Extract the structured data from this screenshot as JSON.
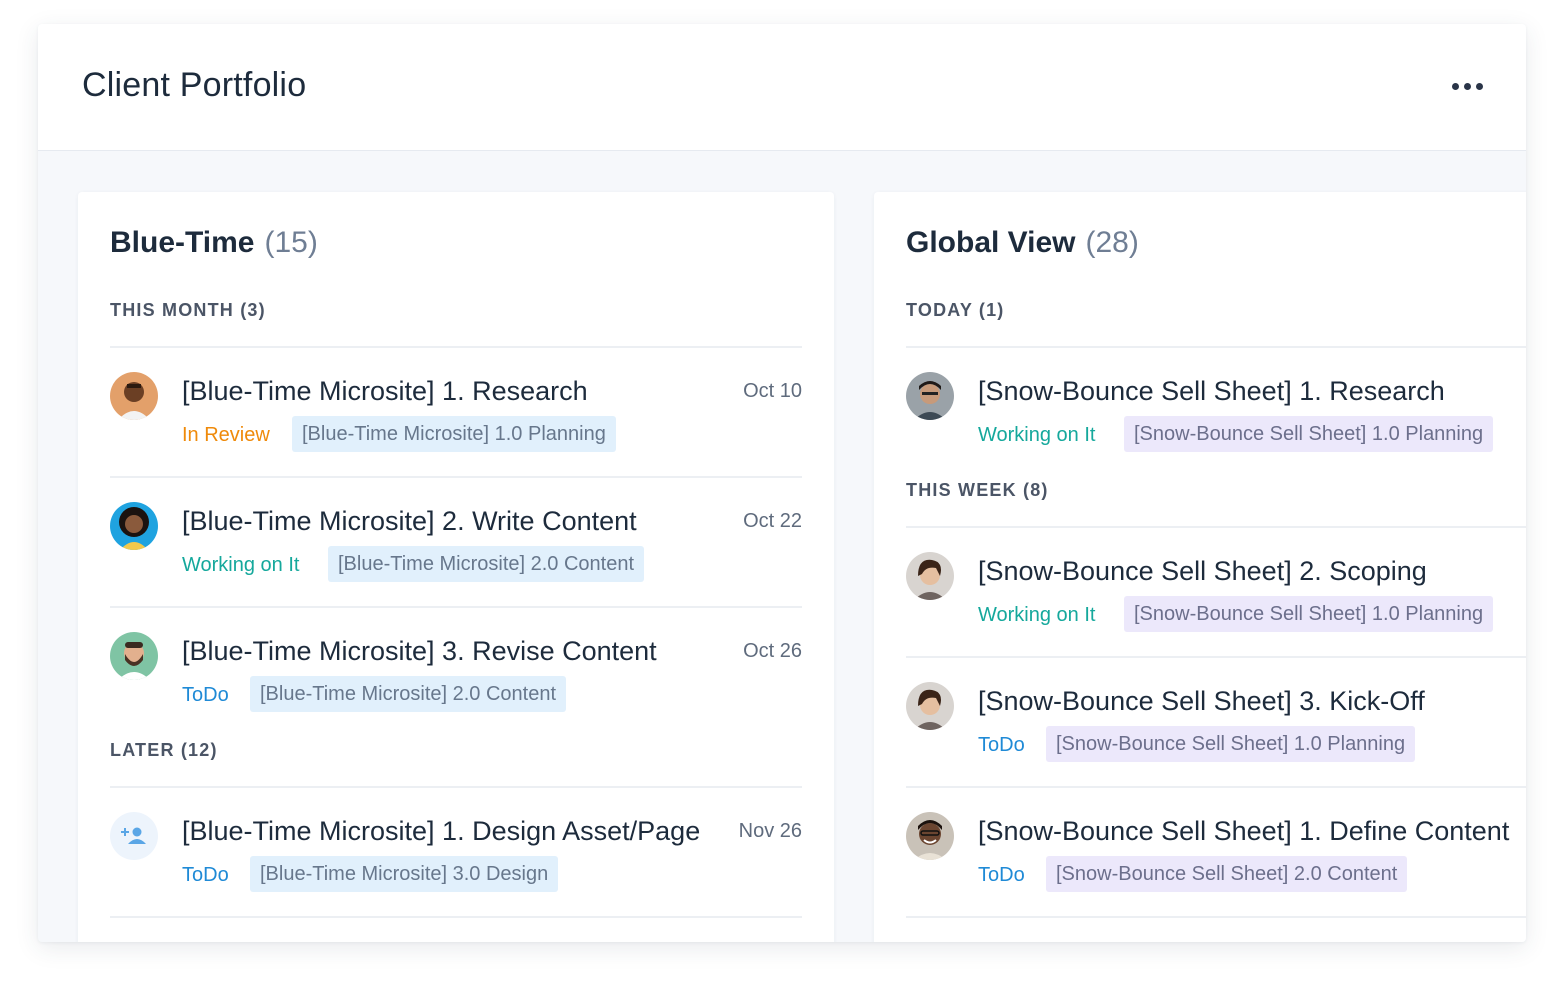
{
  "header": {
    "title": "Client Portfolio"
  },
  "panels": [
    {
      "title": "Blue-Time",
      "count": "(15)",
      "sections": [
        {
          "label": "THIS MONTH (3)",
          "tasks": [
            {
              "title": "[Blue-Time Microsite] 1. Research",
              "date": "Oct 10",
              "status": "In Review",
              "tag": "[Blue-Time Microsite] 1.0 Planning"
            },
            {
              "title": "[Blue-Time Microsite] 2. Write Content",
              "date": "Oct 22",
              "status": "Working on It",
              "tag": "[Blue-Time Microsite] 2.0 Content"
            },
            {
              "title": "[Blue-Time Microsite] 3. Revise Content",
              "date": "Oct 26",
              "status": "ToDo",
              "tag": "[Blue-Time Microsite] 2.0 Content"
            }
          ]
        },
        {
          "label": "LATER (12)",
          "tasks": [
            {
              "title": "[Blue-Time Microsite] 1. Design Asset/Page",
              "date": "Nov 26",
              "status": "ToDo",
              "tag": "[Blue-Time Microsite] 3.0 Design"
            }
          ]
        }
      ]
    },
    {
      "title": "Global View",
      "count": "(28)",
      "sections": [
        {
          "label": "TODAY (1)",
          "tasks": [
            {
              "title": "[Snow-Bounce Sell Sheet] 1. Research",
              "status": "Working on It",
              "tag": "[Snow-Bounce Sell Sheet] 1.0 Planning"
            }
          ]
        },
        {
          "label": "THIS WEEK (8)",
          "tasks": [
            {
              "title": "[Snow-Bounce Sell Sheet] 2. Scoping",
              "status": "Working on It",
              "tag": "[Snow-Bounce Sell Sheet] 1.0 Planning"
            },
            {
              "title": "[Snow-Bounce Sell Sheet] 3. Kick-Off",
              "status": "ToDo",
              "tag": "[Snow-Bounce Sell Sheet] 1.0 Planning"
            },
            {
              "title": "[Snow-Bounce Sell Sheet] 1. Define Content",
              "status": "ToDo",
              "tag": "[Snow-Bounce Sell Sheet] 2.0 Content"
            }
          ]
        }
      ]
    }
  ],
  "colors": {
    "in_review": "#ef8a0a",
    "working_on_it": "#15a89c",
    "todo": "#1f8ad6",
    "tag_blue_bg": "#e1f0fc",
    "tag_purple_bg": "#ece8fb"
  },
  "icons": {
    "more": "more-horizontal-icon",
    "unassigned": "add-user-icon"
  }
}
